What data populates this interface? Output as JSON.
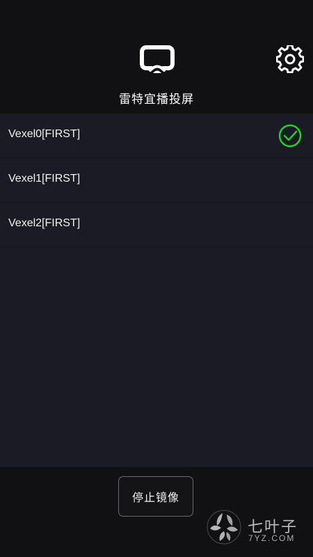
{
  "header": {
    "title": "雷特宜播投屏",
    "logo_icon": "cast-screen-logo-icon",
    "settings_icon": "gear-icon"
  },
  "devices": [
    {
      "label": "Vexel0[FIRST]",
      "selected": true
    },
    {
      "label": "Vexel1[FIRST]",
      "selected": false
    },
    {
      "label": "Vexel2[FIRST]",
      "selected": false
    }
  ],
  "selected_icon": "check-circle-icon",
  "footer": {
    "stop_button_label": "停止镜像"
  },
  "watermark": {
    "text_cn": "七叶子",
    "text_en": "7YZ.COM"
  },
  "colors": {
    "background": "#111113",
    "list_background": "#1b1b26",
    "accent_check": "#22d12a",
    "text": "#ffffff"
  }
}
